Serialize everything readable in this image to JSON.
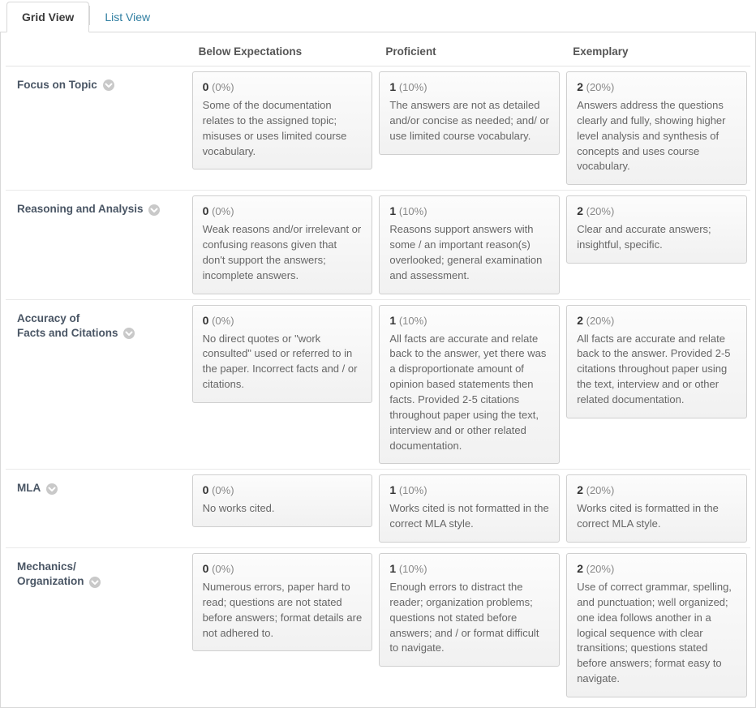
{
  "tabs": {
    "grid": "Grid View",
    "list": "List View"
  },
  "headers": {
    "below": "Below Expectations",
    "proficient": "Proficient",
    "exemplary": "Exemplary"
  },
  "criteria": [
    {
      "name": "Focus on Topic"
    },
    {
      "name": "Reasoning and Analysis"
    },
    {
      "name": "Accuracy of\nFacts and Citations"
    },
    {
      "name": "MLA"
    },
    {
      "name": "Mechanics/\nOrganization"
    }
  ],
  "cells": {
    "r0": {
      "below": {
        "pts": "0",
        "pct": "(0%)",
        "desc": "Some of the documentation relates to the assigned topic; misuses or uses limited course vocabulary."
      },
      "proficient": {
        "pts": "1",
        "pct": "(10%)",
        "desc": "The answers are not as detailed and/or concise as needed; and/ or use limited course vocabulary."
      },
      "exemplary": {
        "pts": "2",
        "pct": "(20%)",
        "desc": "Answers address the questions clearly and fully, showing higher level analysis and synthesis of concepts and uses course vocabulary."
      }
    },
    "r1": {
      "below": {
        "pts": "0",
        "pct": "(0%)",
        "desc": "Weak reasons and/or irrelevant or confusing reasons given that don't support the answers; incomplete answers."
      },
      "proficient": {
        "pts": "1",
        "pct": "(10%)",
        "desc": "Reasons support answers with some / an important reason(s) overlooked; general examination and assessment."
      },
      "exemplary": {
        "pts": "2",
        "pct": "(20%)",
        "desc": "Clear and accurate answers; insightful, specific."
      }
    },
    "r2": {
      "below": {
        "pts": "0",
        "pct": "(0%)",
        "desc": "No direct quotes or \"work consulted\" used or referred to in the paper. Incorrect facts and / or citations."
      },
      "proficient": {
        "pts": "1",
        "pct": "(10%)",
        "desc": "All facts are accurate and relate back to the answer, yet there was a disproportionate amount of opinion based statements then facts. Provided 2-5 citations throughout paper using the text, interview and or other related documentation."
      },
      "exemplary": {
        "pts": "2",
        "pct": "(20%)",
        "desc": "All facts are accurate and relate back to the answer. Provided 2-5 citations throughout paper using the text, interview and or other related documentation."
      }
    },
    "r3": {
      "below": {
        "pts": "0",
        "pct": "(0%)",
        "desc": "No works cited."
      },
      "proficient": {
        "pts": "1",
        "pct": "(10%)",
        "desc": "Works cited is not formatted in the correct MLA style."
      },
      "exemplary": {
        "pts": "2",
        "pct": "(20%)",
        "desc": "Works cited is formatted in the correct MLA style."
      }
    },
    "r4": {
      "below": {
        "pts": "0",
        "pct": "(0%)",
        "desc": "Numerous errors, paper hard to read; questions are not stated before answers; format details are not adhered to."
      },
      "proficient": {
        "pts": "1",
        "pct": "(10%)",
        "desc": "Enough errors to distract the reader; organization problems; questions not stated before answers; and / or format difficult to navigate."
      },
      "exemplary": {
        "pts": "2",
        "pct": "(20%)",
        "desc": "Use of correct grammar, spelling, and punctuation; well organized; one idea follows another in a logical sequence with clear transitions; questions stated before answers; format easy to navigate."
      }
    }
  }
}
